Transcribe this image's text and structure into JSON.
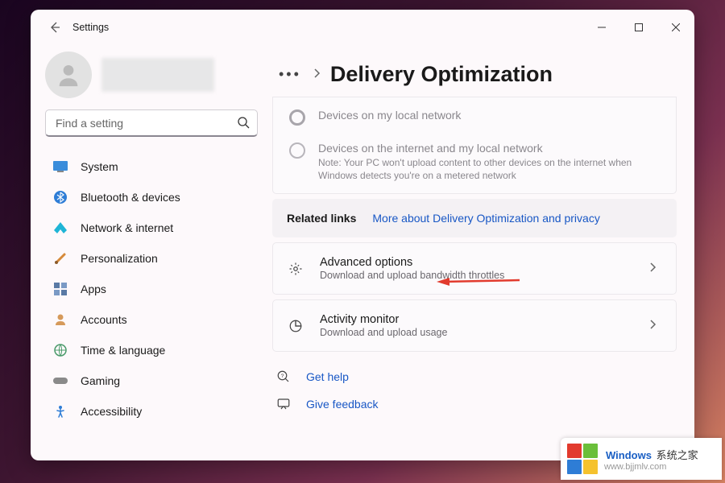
{
  "window": {
    "app_title": "Settings"
  },
  "search": {
    "placeholder": "Find a setting"
  },
  "sidebar": {
    "items": [
      {
        "icon": "🖥️",
        "label": "System"
      },
      {
        "icon": "bt",
        "label": "Bluetooth & devices"
      },
      {
        "icon": "💎",
        "label": "Network & internet"
      },
      {
        "icon": "🖌️",
        "label": "Personalization"
      },
      {
        "icon": "▦",
        "label": "Apps"
      },
      {
        "icon": "👤",
        "label": "Accounts"
      },
      {
        "icon": "🌐",
        "label": "Time & language"
      },
      {
        "icon": "🎮",
        "label": "Gaming"
      },
      {
        "icon": "acc",
        "label": "Accessibility"
      }
    ]
  },
  "breadcrumb": {
    "title": "Delivery Optimization"
  },
  "radios": {
    "opt1": {
      "label": "Devices on my local network"
    },
    "opt2": {
      "label": "Devices on the internet and my local network",
      "note": "Note: Your PC won't upload content to other devices on the internet when Windows detects you're on a metered network"
    }
  },
  "related": {
    "label": "Related links",
    "link": "More about Delivery Optimization and privacy"
  },
  "cards": {
    "advanced": {
      "title": "Advanced options",
      "sub": "Download and upload bandwidth throttles"
    },
    "activity": {
      "title": "Activity monitor",
      "sub": "Download and upload usage"
    }
  },
  "help": {
    "get_help": "Get help",
    "feedback": "Give feedback"
  },
  "watermark": {
    "line1a": "Windows",
    "line1b": "系统之家",
    "line2": "www.bjjmlv.com"
  },
  "colors": {
    "link": "#1857c5",
    "disabled_text": "#8a878d",
    "arrow": "#e23b2e"
  }
}
